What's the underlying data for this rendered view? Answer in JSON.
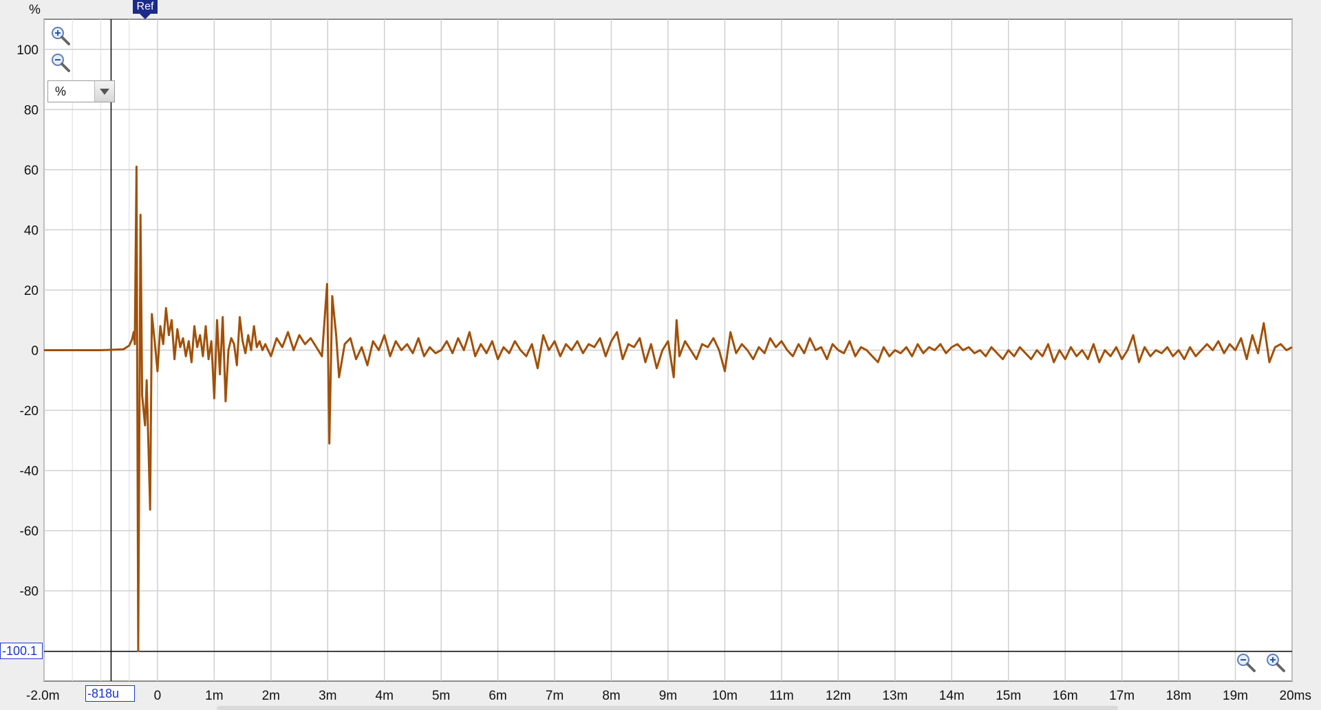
{
  "chart_data": {
    "type": "line",
    "ylabel": "%",
    "xunit": "s",
    "xlim": [
      -0.002,
      0.02
    ],
    "ylim": [
      -110,
      110
    ],
    "x_ticks": [
      {
        "value": -0.002,
        "label": "-2.0m"
      },
      {
        "value": 0,
        "label": "0"
      },
      {
        "value": 0.001,
        "label": "1m"
      },
      {
        "value": 0.002,
        "label": "2m"
      },
      {
        "value": 0.003,
        "label": "3m"
      },
      {
        "value": 0.004,
        "label": "4m"
      },
      {
        "value": 0.005,
        "label": "5m"
      },
      {
        "value": 0.006,
        "label": "6m"
      },
      {
        "value": 0.007,
        "label": "7m"
      },
      {
        "value": 0.008,
        "label": "8m"
      },
      {
        "value": 0.009,
        "label": "9m"
      },
      {
        "value": 0.01,
        "label": "10m"
      },
      {
        "value": 0.011,
        "label": "11m"
      },
      {
        "value": 0.012,
        "label": "12m"
      },
      {
        "value": 0.013,
        "label": "13m"
      },
      {
        "value": 0.014,
        "label": "14m"
      },
      {
        "value": 0.015,
        "label": "15m"
      },
      {
        "value": 0.016,
        "label": "16m"
      },
      {
        "value": 0.017,
        "label": "17m"
      },
      {
        "value": 0.018,
        "label": "18m"
      },
      {
        "value": 0.019,
        "label": "19m"
      },
      {
        "value": 0.02,
        "label": "20ms"
      }
    ],
    "x_minor_ticks": [
      -0.0015,
      -0.001,
      -0.0005
    ],
    "y_ticks": [
      100,
      80,
      60,
      40,
      20,
      0,
      -20,
      -40,
      -60,
      -80
    ],
    "grid": true,
    "series": [
      {
        "color": "#a15008",
        "points": [
          [
            -0.002,
            0
          ],
          [
            -0.001,
            0
          ],
          [
            -0.0006,
            0.3
          ],
          [
            -0.0005,
            1.5
          ],
          [
            -0.00045,
            3.5
          ],
          [
            -0.00042,
            6
          ],
          [
            -0.0004,
            2
          ],
          [
            -0.00037,
            61
          ],
          [
            -0.00034,
            -100
          ],
          [
            -0.0003,
            45
          ],
          [
            -0.00027,
            -15
          ],
          [
            -0.00022,
            -25
          ],
          [
            -0.00019,
            -10
          ],
          [
            -0.00013,
            -53
          ],
          [
            -0.0001,
            12
          ],
          [
            -5e-05,
            3
          ],
          [
            0,
            -7
          ],
          [
            5e-05,
            8
          ],
          [
            0.0001,
            2
          ],
          [
            0.00015,
            14
          ],
          [
            0.0002,
            5
          ],
          [
            0.00025,
            10
          ],
          [
            0.0003,
            -3
          ],
          [
            0.00035,
            7
          ],
          [
            0.0004,
            1
          ],
          [
            0.00045,
            4
          ],
          [
            0.0005,
            -2
          ],
          [
            0.00055,
            3
          ],
          [
            0.0006,
            -4
          ],
          [
            0.00065,
            8
          ],
          [
            0.0007,
            1
          ],
          [
            0.00075,
            5
          ],
          [
            0.0008,
            -2
          ],
          [
            0.00085,
            8
          ],
          [
            0.0009,
            -3
          ],
          [
            0.00095,
            3
          ],
          [
            0.001,
            -16
          ],
          [
            0.00105,
            10
          ],
          [
            0.0011,
            -8
          ],
          [
            0.00115,
            11
          ],
          [
            0.0012,
            -17
          ],
          [
            0.00125,
            0
          ],
          [
            0.0013,
            4
          ],
          [
            0.00135,
            2
          ],
          [
            0.0014,
            -5
          ],
          [
            0.00145,
            11
          ],
          [
            0.0015,
            3
          ],
          [
            0.00155,
            -1
          ],
          [
            0.0016,
            5
          ],
          [
            0.00165,
            0
          ],
          [
            0.0017,
            8
          ],
          [
            0.00175,
            1
          ],
          [
            0.0018,
            3
          ],
          [
            0.00185,
            0
          ],
          [
            0.0019,
            2
          ],
          [
            0.002,
            -2
          ],
          [
            0.0021,
            4
          ],
          [
            0.0022,
            1
          ],
          [
            0.0023,
            6
          ],
          [
            0.0024,
            0
          ],
          [
            0.0025,
            5
          ],
          [
            0.0026,
            2
          ],
          [
            0.0027,
            4
          ],
          [
            0.0028,
            1
          ],
          [
            0.0029,
            -2
          ],
          [
            0.00299,
            22
          ],
          [
            0.00303,
            -31
          ],
          [
            0.00308,
            18
          ],
          [
            0.00315,
            5
          ],
          [
            0.0032,
            -9
          ],
          [
            0.0033,
            2
          ],
          [
            0.0034,
            4
          ],
          [
            0.0035,
            -3
          ],
          [
            0.0036,
            1
          ],
          [
            0.0037,
            -5
          ],
          [
            0.0038,
            3
          ],
          [
            0.0039,
            0
          ],
          [
            0.004,
            5
          ],
          [
            0.0041,
            -2
          ],
          [
            0.0042,
            3
          ],
          [
            0.0043,
            0
          ],
          [
            0.0044,
            2
          ],
          [
            0.0045,
            -1
          ],
          [
            0.0046,
            4
          ],
          [
            0.0047,
            -2
          ],
          [
            0.0048,
            1
          ],
          [
            0.0049,
            -1
          ],
          [
            0.005,
            0
          ],
          [
            0.0051,
            3
          ],
          [
            0.0052,
            -1
          ],
          [
            0.0053,
            4
          ],
          [
            0.0054,
            0
          ],
          [
            0.0055,
            6
          ],
          [
            0.0056,
            -2
          ],
          [
            0.0057,
            2
          ],
          [
            0.0058,
            -1
          ],
          [
            0.0059,
            3
          ],
          [
            0.006,
            -3
          ],
          [
            0.0061,
            1
          ],
          [
            0.0062,
            -1
          ],
          [
            0.0063,
            3
          ],
          [
            0.0064,
            0
          ],
          [
            0.0065,
            -2
          ],
          [
            0.0066,
            2
          ],
          [
            0.0067,
            -6
          ],
          [
            0.0068,
            5
          ],
          [
            0.0069,
            0
          ],
          [
            0.007,
            3
          ],
          [
            0.0071,
            -2
          ],
          [
            0.0072,
            2
          ],
          [
            0.0073,
            0
          ],
          [
            0.0074,
            3
          ],
          [
            0.0075,
            -1
          ],
          [
            0.0076,
            2
          ],
          [
            0.0077,
            1
          ],
          [
            0.0078,
            4
          ],
          [
            0.0079,
            -2
          ],
          [
            0.008,
            3
          ],
          [
            0.0081,
            6
          ],
          [
            0.0082,
            -3
          ],
          [
            0.0083,
            2
          ],
          [
            0.0084,
            1
          ],
          [
            0.0085,
            4
          ],
          [
            0.0086,
            -4
          ],
          [
            0.0087,
            2
          ],
          [
            0.0088,
            -6
          ],
          [
            0.0089,
            0
          ],
          [
            0.009,
            3
          ],
          [
            0.0091,
            -9
          ],
          [
            0.00915,
            10
          ],
          [
            0.0092,
            -2
          ],
          [
            0.0093,
            3
          ],
          [
            0.0094,
            0
          ],
          [
            0.0095,
            -3
          ],
          [
            0.0096,
            2
          ],
          [
            0.0097,
            1
          ],
          [
            0.0098,
            4
          ],
          [
            0.0099,
            0
          ],
          [
            0.01,
            -7
          ],
          [
            0.0101,
            6
          ],
          [
            0.0102,
            -1
          ],
          [
            0.0103,
            2
          ],
          [
            0.0104,
            0
          ],
          [
            0.0105,
            -3
          ],
          [
            0.0106,
            1
          ],
          [
            0.0107,
            -1
          ],
          [
            0.0108,
            4
          ],
          [
            0.0109,
            1
          ],
          [
            0.011,
            3
          ],
          [
            0.0111,
            0
          ],
          [
            0.0112,
            -2
          ],
          [
            0.0113,
            2
          ],
          [
            0.0114,
            -1
          ],
          [
            0.0115,
            4
          ],
          [
            0.0116,
            0
          ],
          [
            0.0117,
            1
          ],
          [
            0.0118,
            -3
          ],
          [
            0.0119,
            2
          ],
          [
            0.012,
            0
          ],
          [
            0.0121,
            -1
          ],
          [
            0.0122,
            3
          ],
          [
            0.0123,
            -2
          ],
          [
            0.0124,
            1
          ],
          [
            0.0125,
            0
          ],
          [
            0.0126,
            -2
          ],
          [
            0.0127,
            -4
          ],
          [
            0.0128,
            1
          ],
          [
            0.0129,
            -2
          ],
          [
            0.013,
            0
          ],
          [
            0.0131,
            -1
          ],
          [
            0.0132,
            1
          ],
          [
            0.0133,
            -2
          ],
          [
            0.0134,
            2
          ],
          [
            0.0135,
            -1
          ],
          [
            0.0136,
            1
          ],
          [
            0.0137,
            0
          ],
          [
            0.0138,
            2
          ],
          [
            0.0139,
            -1
          ],
          [
            0.014,
            1
          ],
          [
            0.0141,
            2
          ],
          [
            0.0142,
            0
          ],
          [
            0.0143,
            1
          ],
          [
            0.0144,
            -1
          ],
          [
            0.0145,
            0
          ],
          [
            0.0146,
            -2
          ],
          [
            0.0147,
            1
          ],
          [
            0.0148,
            -1
          ],
          [
            0.0149,
            -3
          ],
          [
            0.015,
            0
          ],
          [
            0.0151,
            -2
          ],
          [
            0.0152,
            1
          ],
          [
            0.0153,
            -1
          ],
          [
            0.0154,
            -3
          ],
          [
            0.0155,
            0
          ],
          [
            0.0156,
            -2
          ],
          [
            0.0157,
            2
          ],
          [
            0.0158,
            -4
          ],
          [
            0.0159,
            0
          ],
          [
            0.016,
            -3
          ],
          [
            0.0161,
            1
          ],
          [
            0.0162,
            -2
          ],
          [
            0.0163,
            0
          ],
          [
            0.0164,
            -3
          ],
          [
            0.0165,
            2
          ],
          [
            0.0166,
            -4
          ],
          [
            0.0167,
            0
          ],
          [
            0.0168,
            -2
          ],
          [
            0.0169,
            1
          ],
          [
            0.017,
            -3
          ],
          [
            0.0171,
            0
          ],
          [
            0.0172,
            5
          ],
          [
            0.0173,
            -4
          ],
          [
            0.0174,
            1
          ],
          [
            0.0175,
            -2
          ],
          [
            0.0176,
            0
          ],
          [
            0.0177,
            -1
          ],
          [
            0.0178,
            1
          ],
          [
            0.0179,
            -2
          ],
          [
            0.018,
            0
          ],
          [
            0.0181,
            -3
          ],
          [
            0.0182,
            1
          ],
          [
            0.0183,
            -2
          ],
          [
            0.0184,
            0
          ],
          [
            0.0185,
            2
          ],
          [
            0.0186,
            0
          ],
          [
            0.0187,
            3
          ],
          [
            0.0188,
            -1
          ],
          [
            0.0189,
            2
          ],
          [
            0.019,
            0
          ],
          [
            0.0191,
            4
          ],
          [
            0.0192,
            -3
          ],
          [
            0.0193,
            5
          ],
          [
            0.0194,
            -1
          ],
          [
            0.0195,
            9
          ],
          [
            0.0196,
            -4
          ],
          [
            0.0197,
            1
          ],
          [
            0.0198,
            2
          ],
          [
            0.0199,
            0
          ],
          [
            0.02,
            1
          ]
        ]
      }
    ],
    "reference_line_y": -100.1
  },
  "cursor": {
    "x_label": "-818u",
    "y_label": "-100.1",
    "x_value": -0.000818,
    "y_value": -100.1
  },
  "ref_marker": {
    "label": "Ref",
    "x_value": -0.00028
  },
  "unit_selector": {
    "value": "%"
  },
  "icons": {
    "zoom_in": "zoom-in-icon",
    "zoom_out": "zoom-out-icon"
  }
}
